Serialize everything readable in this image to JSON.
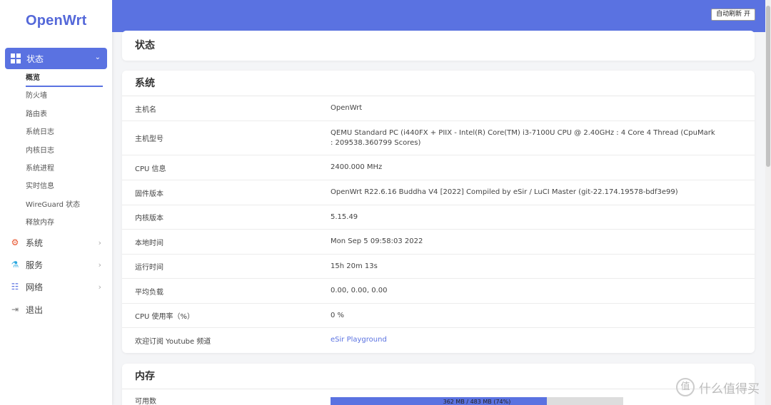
{
  "brand": "OpenWrt",
  "sidebar": {
    "active_menu": {
      "label": "状态",
      "icon": "dashboard-icon"
    },
    "submenu": [
      "概览",
      "防火墙",
      "路由表",
      "系统日志",
      "内核日志",
      "系统进程",
      "实时信息",
      "WireGuard 状态",
      "释放内存"
    ],
    "items": [
      {
        "label": "系统",
        "icon": "gear-icon"
      },
      {
        "label": "服务",
        "icon": "services-icon"
      },
      {
        "label": "网络",
        "icon": "network-icon"
      },
      {
        "label": "退出",
        "icon": "logout-icon"
      }
    ]
  },
  "header": {
    "refresh_label": "自动刷新 开"
  },
  "status_card": {
    "title": "状态"
  },
  "system_card": {
    "title": "系统",
    "rows": [
      {
        "key": "主机名",
        "value": "OpenWrt"
      },
      {
        "key": "主机型号",
        "value": "QEMU Standard PC (i440FX + PIIX - Intel(R) Core(TM) i3-7100U CPU @ 2.40GHz : 4 Core 4 Thread (CpuMark : 209538.360799 Scores)"
      },
      {
        "key": "CPU 信息",
        "value": "2400.000 MHz"
      },
      {
        "key": "固件版本",
        "value": "OpenWrt R22.6.16 Buddha V4 [2022] Compiled by eSir / LuCI Master (git-22.174.19578-bdf3e99)"
      },
      {
        "key": "内核版本",
        "value": "5.15.49"
      },
      {
        "key": "本地时间",
        "value": "Mon Sep 5 09:58:03 2022"
      },
      {
        "key": "运行时间",
        "value": "15h 20m 13s"
      },
      {
        "key": "平均负载",
        "value": "0.00, 0.00, 0.00"
      },
      {
        "key": "CPU 使用率（%）",
        "value": "0 %"
      },
      {
        "key": "欢迎订阅 Youtube 频道",
        "value": "eSir Playground"
      }
    ]
  },
  "memory_card": {
    "title": "内存",
    "rows": [
      {
        "key": "可用数",
        "text": "362 MB / 483 MB (74%)",
        "fraction": 0.74
      }
    ]
  },
  "watermark": {
    "text": "什么值得买",
    "badge": "值"
  },
  "colors": {
    "accent": "#5a72e1",
    "brand": "#5468d9"
  }
}
